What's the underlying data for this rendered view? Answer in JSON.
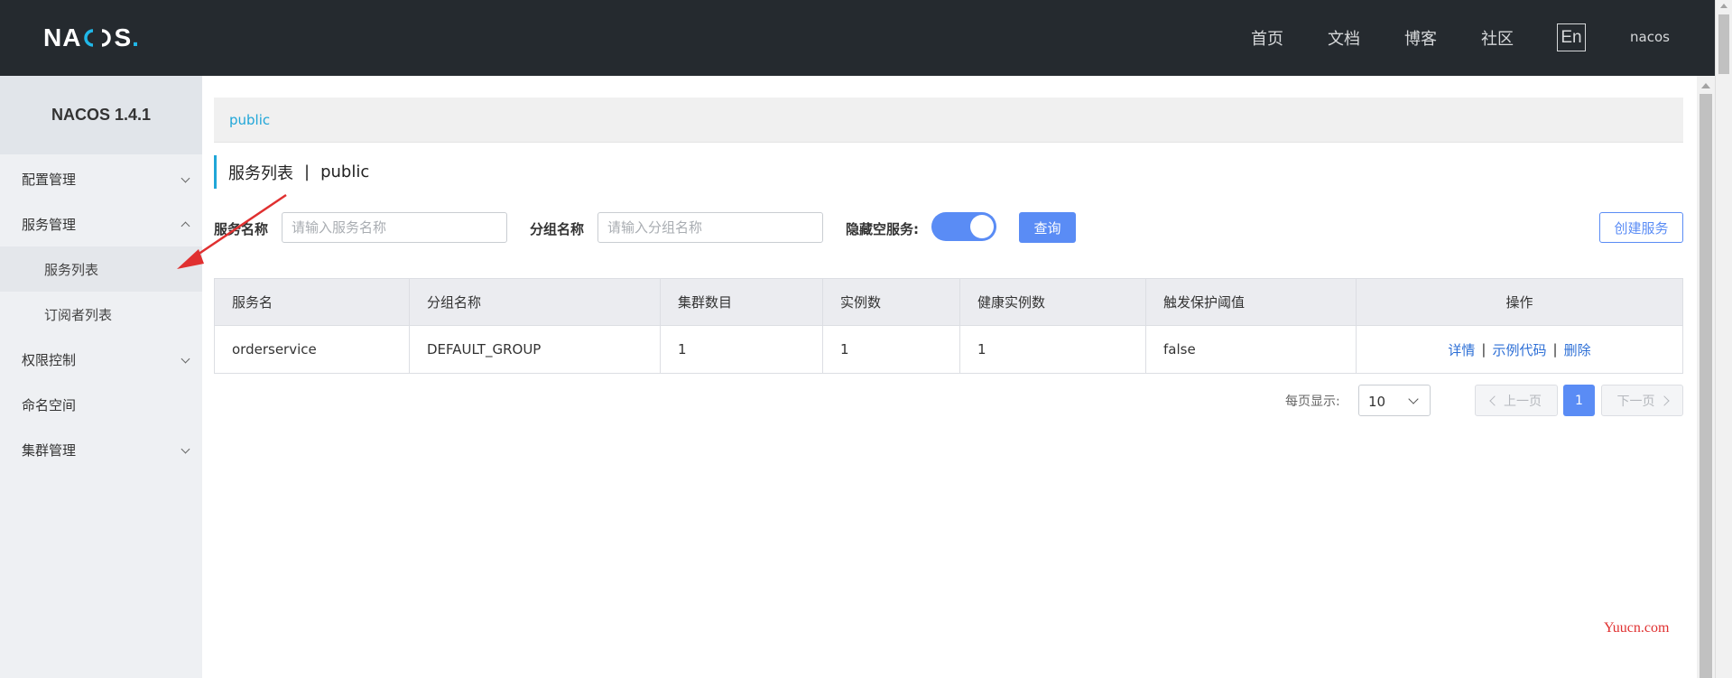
{
  "header": {
    "logo": "NACOS.",
    "nav": [
      "首页",
      "文档",
      "博客",
      "社区"
    ],
    "lang": "En",
    "user": "nacos"
  },
  "sidebar": {
    "version": "NACOS 1.4.1",
    "items": [
      {
        "label": "配置管理",
        "expandable": true,
        "expanded": false
      },
      {
        "label": "服务管理",
        "expandable": true,
        "expanded": true
      },
      {
        "label": "服务列表",
        "sub": true,
        "active": true
      },
      {
        "label": "订阅者列表",
        "sub": true
      },
      {
        "label": "权限控制",
        "expandable": true,
        "expanded": false
      },
      {
        "label": "命名空间"
      },
      {
        "label": "集群管理",
        "expandable": true,
        "expanded": false
      }
    ]
  },
  "breadcrumb": "public",
  "page": {
    "title": "服务列表",
    "separator": "|",
    "namespace": "public"
  },
  "filters": {
    "service_name_label": "服务名称",
    "service_name_placeholder": "请输入服务名称",
    "group_name_label": "分组名称",
    "group_name_placeholder": "请输入分组名称",
    "hide_empty_label": "隐藏空服务:",
    "hide_empty_on": true,
    "query_button": "查询",
    "create_button": "创建服务"
  },
  "table": {
    "columns": [
      "服务名",
      "分组名称",
      "集群数目",
      "实例数",
      "健康实例数",
      "触发保护阈值",
      "操作"
    ],
    "rows": [
      {
        "service": "orderservice",
        "group": "DEFAULT_GROUP",
        "clusters": "1",
        "instances": "1",
        "healthy": "1",
        "threshold": "false"
      }
    ],
    "actions": [
      "详情",
      "示例代码",
      "删除"
    ],
    "action_separator": "|"
  },
  "pagination": {
    "per_page_label": "每页显示:",
    "per_page_value": "10",
    "prev_label": "上一页",
    "next_label": "下一页",
    "current_page": "1"
  },
  "watermark": "Yuucn.com",
  "colors": {
    "header_bg": "#252a2f",
    "accent": "#20a6d8",
    "primary": "#5a8cf5",
    "link": "#2d6fd6",
    "annotation": "#e03030"
  }
}
